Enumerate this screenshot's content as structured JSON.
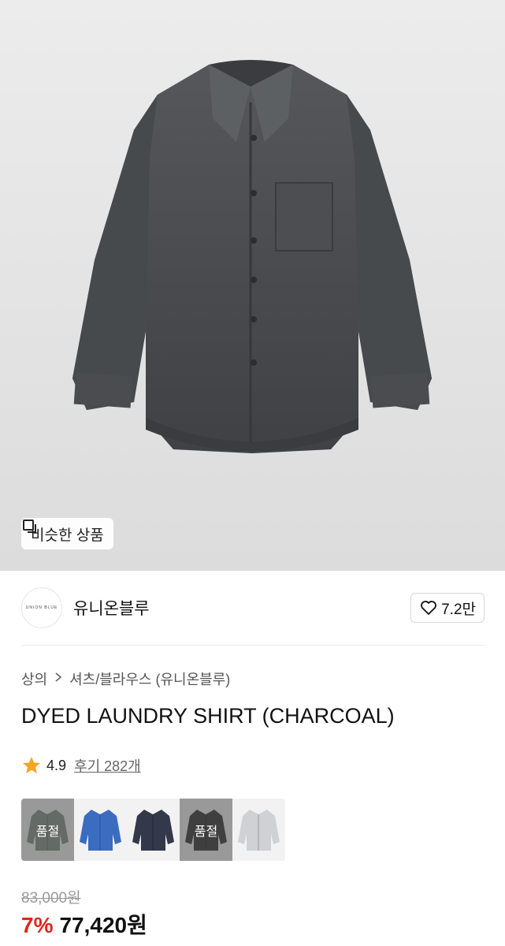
{
  "hero": {
    "similar_button_label": "비슷한 상품",
    "similar_icon": "copy-icon"
  },
  "brand": {
    "logo_text": "UNION BLUE",
    "name": "유니온블루",
    "like_count": "7.2만",
    "like_icon": "heart-icon"
  },
  "breadcrumb": {
    "items": [
      "상의",
      "셔츠/블라우스 (유니온블루)"
    ],
    "separator_icon": "chevron-right-icon"
  },
  "product": {
    "title": "DYED LAUNDRY SHIRT (CHARCOAL)",
    "rating": "4.9",
    "reviews_label": "후기 282개",
    "rating_icon": "star-icon",
    "star_color": "#f5a623"
  },
  "swatches": [
    {
      "color": "#7d8a80",
      "soldout": true,
      "label": "품절"
    },
    {
      "color": "#3a6cc0",
      "soldout": false,
      "label": ""
    },
    {
      "color": "#33384a",
      "soldout": false,
      "label": ""
    },
    {
      "color": "#2a2a2a",
      "soldout": true,
      "label": "품절"
    },
    {
      "color": "#cfd1d4",
      "soldout": false,
      "label": ""
    }
  ],
  "price": {
    "original": "83,000원",
    "discount": "7%",
    "final": "77,420원",
    "discount_color": "#e2261b"
  }
}
